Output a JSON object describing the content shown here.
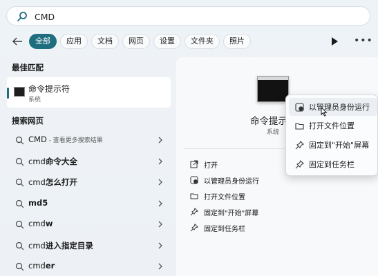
{
  "search": {
    "value": "CMD"
  },
  "filters": [
    "全部",
    "应用",
    "文档",
    "网页",
    "设置",
    "文件夹",
    "照片"
  ],
  "best_match": {
    "section_title": "最佳匹配",
    "title": "命令提示符",
    "subtitle": "系统"
  },
  "web": {
    "section_title": "搜索网页",
    "items": [
      {
        "prefix": "CMD",
        "bold": "",
        "sub": " - 查看更多搜索结果"
      },
      {
        "prefix": "cmd",
        "bold": "命令大全",
        "sub": ""
      },
      {
        "prefix": "cmd",
        "bold": "怎么打开",
        "sub": ""
      },
      {
        "prefix": "",
        "bold": "md5",
        "sub": ""
      },
      {
        "prefix": "cmd",
        "bold": "w",
        "sub": ""
      },
      {
        "prefix": "cmd",
        "bold": "进入指定目录",
        "sub": ""
      },
      {
        "prefix": "cmd",
        "bold": "er",
        "sub": ""
      }
    ]
  },
  "panel": {
    "title": "命令提示符",
    "subtitle": "系统",
    "actions": [
      {
        "label": "打开",
        "icon": "open-icon"
      },
      {
        "label": "以管理员身份运行",
        "icon": "shield-icon"
      },
      {
        "label": "打开文件位置",
        "icon": "folder-icon"
      },
      {
        "label": "固定到\"开始\"屏幕",
        "icon": "pin-icon"
      },
      {
        "label": "固定到任务栏",
        "icon": "pin-icon"
      }
    ]
  },
  "context_menu": {
    "items": [
      {
        "label": "以管理员身份运行",
        "icon": "shield-icon"
      },
      {
        "label": "打开文件位置",
        "icon": "folder-icon"
      },
      {
        "label": "固定到\"开始\"屏幕",
        "icon": "pin-icon"
      },
      {
        "label": "固定到任务栏",
        "icon": "pin-icon"
      }
    ]
  },
  "colors": {
    "accent": "#1f6e80",
    "background": "#edf1f5",
    "panel": "#f7f9fb"
  }
}
